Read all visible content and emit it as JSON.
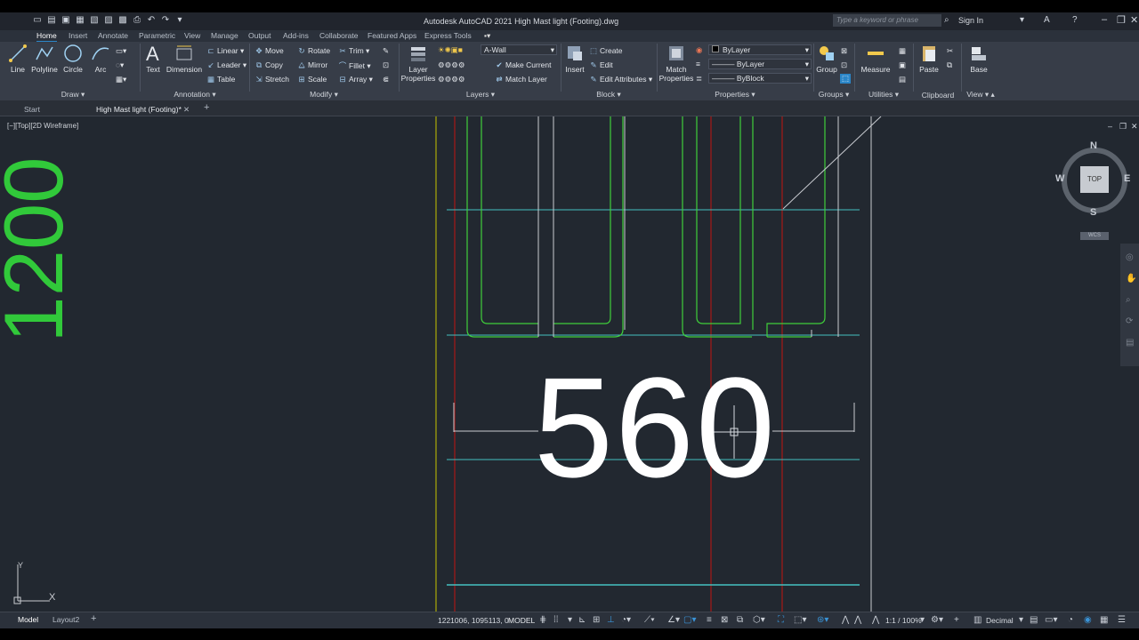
{
  "window": {
    "title": "Autodesk AutoCAD 2021    High Mast light (Footing).dwg",
    "search_placeholder": "Type a keyword or phrase",
    "sign_in": "Sign In"
  },
  "ribbon_tabs": [
    "Home",
    "Insert",
    "Annotate",
    "Parametric",
    "View",
    "Manage",
    "Output",
    "Add-ins",
    "Collaborate",
    "Featured Apps",
    "Express Tools"
  ],
  "ribbon": {
    "draw": {
      "title": "Draw",
      "line": "Line",
      "polyline": "Polyline",
      "circle": "Circle",
      "arc": "Arc"
    },
    "annotation": {
      "title": "Annotation",
      "text": "Text",
      "dimension": "Dimension",
      "linear": "Linear",
      "leader": "Leader",
      "table": "Table"
    },
    "modify": {
      "title": "Modify",
      "move": "Move",
      "rotate": "Rotate",
      "trim": "Trim",
      "copy": "Copy",
      "mirror": "Mirror",
      "fillet": "Fillet",
      "stretch": "Stretch",
      "scale": "Scale",
      "array": "Array"
    },
    "layers": {
      "title": "Layers",
      "layer_properties": "Layer Properties",
      "current_layer": "A-Wall",
      "make_current": "Make Current",
      "match_layer": "Match Layer"
    },
    "block": {
      "title": "Block",
      "insert": "Insert",
      "create": "Create",
      "edit": "Edit",
      "edit_attributes": "Edit Attributes"
    },
    "properties": {
      "title": "Properties",
      "match_properties": "Match Properties",
      "color": "ByLayer",
      "linetype": "ByLayer",
      "lineweight": "ByBlock"
    },
    "groups": {
      "title": "Groups",
      "group": "Group"
    },
    "utilities": {
      "title": "Utilities",
      "measure": "Measure"
    },
    "clipboard": {
      "title": "Clipboard",
      "paste": "Paste"
    },
    "view": {
      "title": "View",
      "base": "Base"
    }
  },
  "doc_tabs": {
    "start": "Start",
    "active": "High Mast light (Footing)*"
  },
  "viewport": {
    "label": "[−][Top][2D Wireframe]",
    "dimension_text": "560",
    "side_text": "1200",
    "viewcube": {
      "n": "N",
      "s": "S",
      "e": "E",
      "w": "W",
      "top": "TOP",
      "wcs": "WCS"
    }
  },
  "status": {
    "layout_tabs": [
      "Model",
      "Layout2"
    ],
    "coordinates": "1221006, 1095113, 0",
    "model": "MODEL",
    "scale": "1:1 / 100%",
    "units": "Decimal"
  },
  "colors": {
    "viewport_bg": "#222830",
    "ribbon_bg": "#373d48",
    "green_line": "#3fcf3a",
    "cyan_line": "#44c1c1",
    "red_line": "#8c1a1a",
    "accent": "#2b86c8"
  }
}
